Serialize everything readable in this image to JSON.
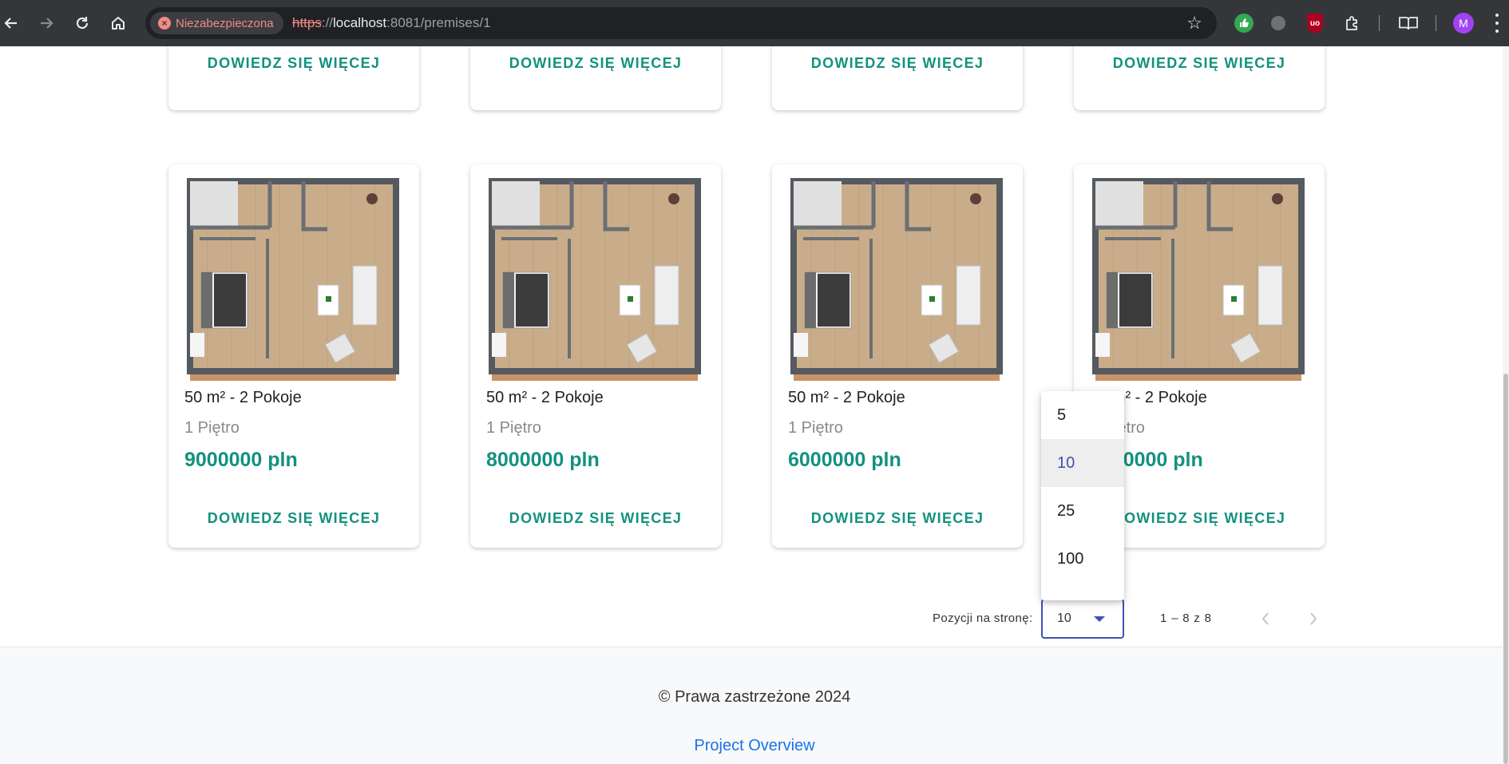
{
  "browser": {
    "security_label": "Niezabezpieczona",
    "url_scheme": "https",
    "url_sep": "://",
    "url_host": "localhost",
    "url_rest": ":8081/premises/1",
    "profile_initial": "M"
  },
  "top_cards": [
    {
      "button": "DOWIEDZ SIĘ WIĘCEJ"
    },
    {
      "button": "DOWIEDZ SIĘ WIĘCEJ"
    },
    {
      "button": "DOWIEDZ SIĘ WIĘCEJ"
    },
    {
      "button": "DOWIEDZ SIĘ WIĘCEJ"
    }
  ],
  "cards": [
    {
      "title": "50 m² - 2 Pokoje",
      "floor": "1 Piętro",
      "price": "9000000 pln",
      "button": "DOWIEDZ SIĘ WIĘCEJ"
    },
    {
      "title": "50 m² - 2 Pokoje",
      "floor": "1 Piętro",
      "price": "8000000 pln",
      "button": "DOWIEDZ SIĘ WIĘCEJ"
    },
    {
      "title": "50 m² - 2 Pokoje",
      "floor": "1 Piętro",
      "price": "6000000 pln",
      "button": "DOWIEDZ SIĘ WIĘCEJ"
    },
    {
      "title": "50 m² - 2 Pokoje",
      "floor": "1 Piętro",
      "price": "5000000 pln",
      "button": "DOWIEDZ SIĘ WIĘCEJ"
    }
  ],
  "paginator": {
    "label": "Pozycji na stronę:",
    "selected": "10",
    "range": "1 – 8 z 8",
    "options": [
      "5",
      "10",
      "25",
      "100"
    ]
  },
  "footer": {
    "copyright": "© Prawa zastrzeżone 2024",
    "link": "Project Overview"
  },
  "colors": {
    "accent": "#13917f",
    "select_border": "#3f51b5",
    "link": "#1a73e8"
  }
}
